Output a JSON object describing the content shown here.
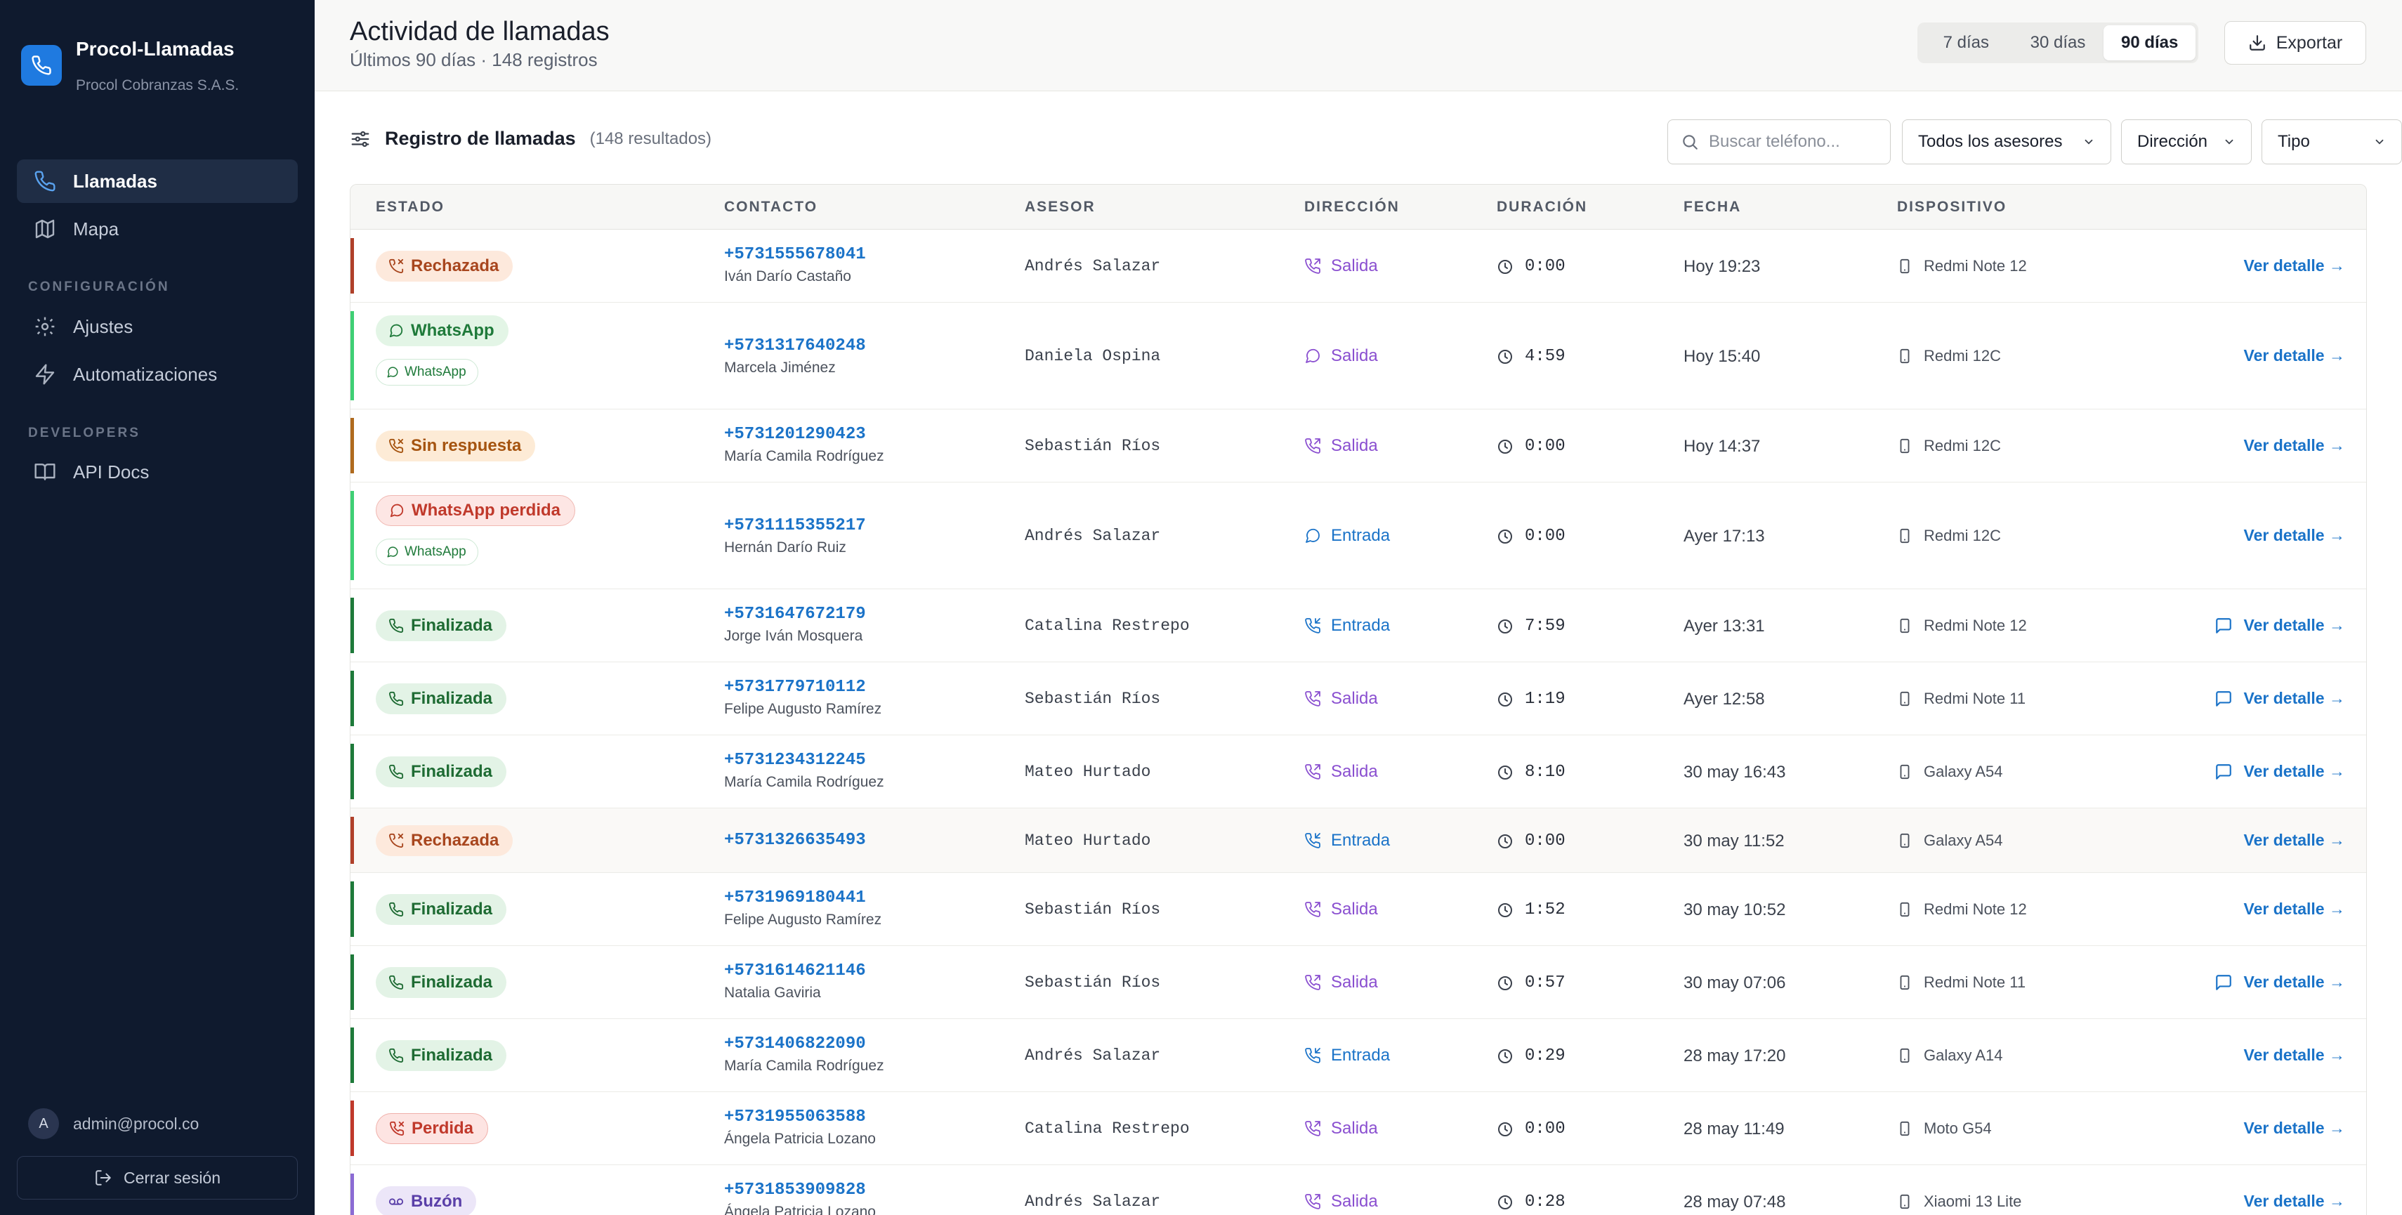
{
  "sidebar": {
    "brand_title": "Procol-Llamadas",
    "brand_subtitle": "Procol Cobranzas S.A.S.",
    "nav": [
      {
        "label": "Llamadas",
        "icon": "phone-icon",
        "active": true
      },
      {
        "label": "Mapa",
        "icon": "map-icon",
        "active": false
      }
    ],
    "config_section": "CONFIGURACIÓN",
    "config_items": [
      {
        "label": "Ajustes",
        "icon": "gear-icon"
      },
      {
        "label": "Automatizaciones",
        "icon": "lightning-icon"
      }
    ],
    "dev_section": "DEVELOPERS",
    "dev_items": [
      {
        "label": "API Docs",
        "icon": "book-icon"
      }
    ],
    "user_initial": "A",
    "user_email": "admin@procol.co",
    "logout_label": "Cerrar sesión"
  },
  "header": {
    "title": "Actividad de llamadas",
    "subtitle": "Últimos 90 días · 148 registros",
    "ranges": [
      "7 días",
      "30 días",
      "90 días"
    ],
    "active_range": "90 días",
    "export_label": "Exportar"
  },
  "filters": {
    "title": "Registro de llamadas",
    "count": "(148 resultados)",
    "search_placeholder": "Buscar teléfono...",
    "advisor_select": "Todos los asesores",
    "direction_select": "Dirección",
    "type_select": "Tipo"
  },
  "table": {
    "columns": [
      "ESTADO",
      "CONTACTO",
      "ASESOR",
      "DIRECCIÓN",
      "DURACIÓN",
      "FECHA",
      "DISPOSITIVO"
    ],
    "detail_label": "Ver detalle →",
    "rows": [
      {
        "status": "Rechazada",
        "kind": "rejected",
        "phone": "+5731555678041",
        "name": "Iván Darío Castaño",
        "advisor": "Andrés Salazar",
        "direction": "Salida",
        "dir_icon": "phone-outgoing-icon",
        "duration": "0:00",
        "date": "Hoy 19:23",
        "device": "Redmi Note 12",
        "note": false
      },
      {
        "status": "WhatsApp",
        "kind": "whatsapp",
        "sub": "WhatsApp",
        "phone": "+5731317640248",
        "name": "Marcela Jiménez",
        "advisor": "Daniela Ospina",
        "direction": "Salida",
        "dir_icon": "chat-bubble-icon",
        "duration": "4:59",
        "date": "Hoy 15:40",
        "device": "Redmi 12C",
        "note": false
      },
      {
        "status": "Sin respuesta",
        "kind": "noanswer",
        "phone": "+5731201290423",
        "name": "María Camila Rodríguez",
        "advisor": "Sebastián Ríos",
        "direction": "Salida",
        "dir_icon": "phone-outgoing-icon",
        "duration": "0:00",
        "date": "Hoy 14:37",
        "device": "Redmi 12C",
        "note": false
      },
      {
        "status": "WhatsApp perdida",
        "kind": "wa_missed",
        "sub": "WhatsApp",
        "phone": "+5731115355217",
        "name": "Hernán Darío Ruiz",
        "advisor": "Andrés Salazar",
        "direction": "Entrada",
        "dir_icon": "chat-bubble-icon",
        "duration": "0:00",
        "date": "Ayer 17:13",
        "device": "Redmi 12C",
        "note": false
      },
      {
        "status": "Finalizada",
        "kind": "done",
        "phone": "+5731647672179",
        "name": "Jorge Iván Mosquera",
        "advisor": "Catalina Restrepo",
        "direction": "Entrada",
        "dir_icon": "phone-incoming-icon",
        "duration": "7:59",
        "date": "Ayer 13:31",
        "device": "Redmi Note 12",
        "note": true
      },
      {
        "status": "Finalizada",
        "kind": "done",
        "phone": "+5731779710112",
        "name": "Felipe Augusto Ramírez",
        "advisor": "Sebastián Ríos",
        "direction": "Salida",
        "dir_icon": "phone-outgoing-icon",
        "duration": "1:19",
        "date": "Ayer 12:58",
        "device": "Redmi Note 11",
        "note": true
      },
      {
        "status": "Finalizada",
        "kind": "done",
        "phone": "+5731234312245",
        "name": "María Camila Rodríguez",
        "advisor": "Mateo Hurtado",
        "direction": "Salida",
        "dir_icon": "phone-outgoing-icon",
        "duration": "8:10",
        "date": "30 may 16:43",
        "device": "Galaxy A54",
        "note": true
      },
      {
        "status": "Rechazada",
        "kind": "rejected",
        "phone": "+5731326635493",
        "name": "",
        "advisor": "Mateo Hurtado",
        "direction": "Entrada",
        "dir_icon": "phone-incoming-icon",
        "duration": "0:00",
        "date": "30 may 11:52",
        "device": "Galaxy A54",
        "note": false,
        "highlight": true
      },
      {
        "status": "Finalizada",
        "kind": "done",
        "phone": "+5731969180441",
        "name": "Felipe Augusto Ramírez",
        "advisor": "Sebastián Ríos",
        "direction": "Salida",
        "dir_icon": "phone-outgoing-icon",
        "duration": "1:52",
        "date": "30 may 10:52",
        "device": "Redmi Note 12",
        "note": false
      },
      {
        "status": "Finalizada",
        "kind": "done",
        "phone": "+5731614621146",
        "name": "Natalia Gaviria",
        "advisor": "Sebastián Ríos",
        "direction": "Salida",
        "dir_icon": "phone-outgoing-icon",
        "duration": "0:57",
        "date": "30 may 07:06",
        "device": "Redmi Note 11",
        "note": true
      },
      {
        "status": "Finalizada",
        "kind": "done",
        "phone": "+5731406822090",
        "name": "María Camila Rodríguez",
        "advisor": "Andrés Salazar",
        "direction": "Entrada",
        "dir_icon": "phone-incoming-icon",
        "duration": "0:29",
        "date": "28 may 17:20",
        "device": "Galaxy A14",
        "note": false
      },
      {
        "status": "Perdida",
        "kind": "missed",
        "phone": "+5731955063588",
        "name": "Ángela Patricia Lozano",
        "advisor": "Catalina Restrepo",
        "direction": "Salida",
        "dir_icon": "phone-outgoing-icon",
        "duration": "0:00",
        "date": "28 may 11:49",
        "device": "Moto G54",
        "note": false
      },
      {
        "status": "Buzón",
        "kind": "voicemail",
        "phone": "+5731853909828",
        "name": "Ángela Patricia Lozano",
        "advisor": "Andrés Salazar",
        "direction": "Salida",
        "dir_icon": "phone-outgoing-icon",
        "duration": "0:28",
        "date": "28 may 07:48",
        "device": "Xiaomi 13 Lite",
        "note": false
      }
    ]
  },
  "colors": {
    "sidebar_bg": "#0f1a2e",
    "brand_accent": "#1f7ae0",
    "link": "#1b73c8",
    "outgoing": "#8a4fd0",
    "incoming": "#1b73c8",
    "done": "#1e7a3a",
    "rejected": "#b0402a",
    "noanswer": "#a85a12",
    "whatsapp": "#25a55a",
    "missed": "#c0392b",
    "voicemail": "#6b4bb8"
  }
}
